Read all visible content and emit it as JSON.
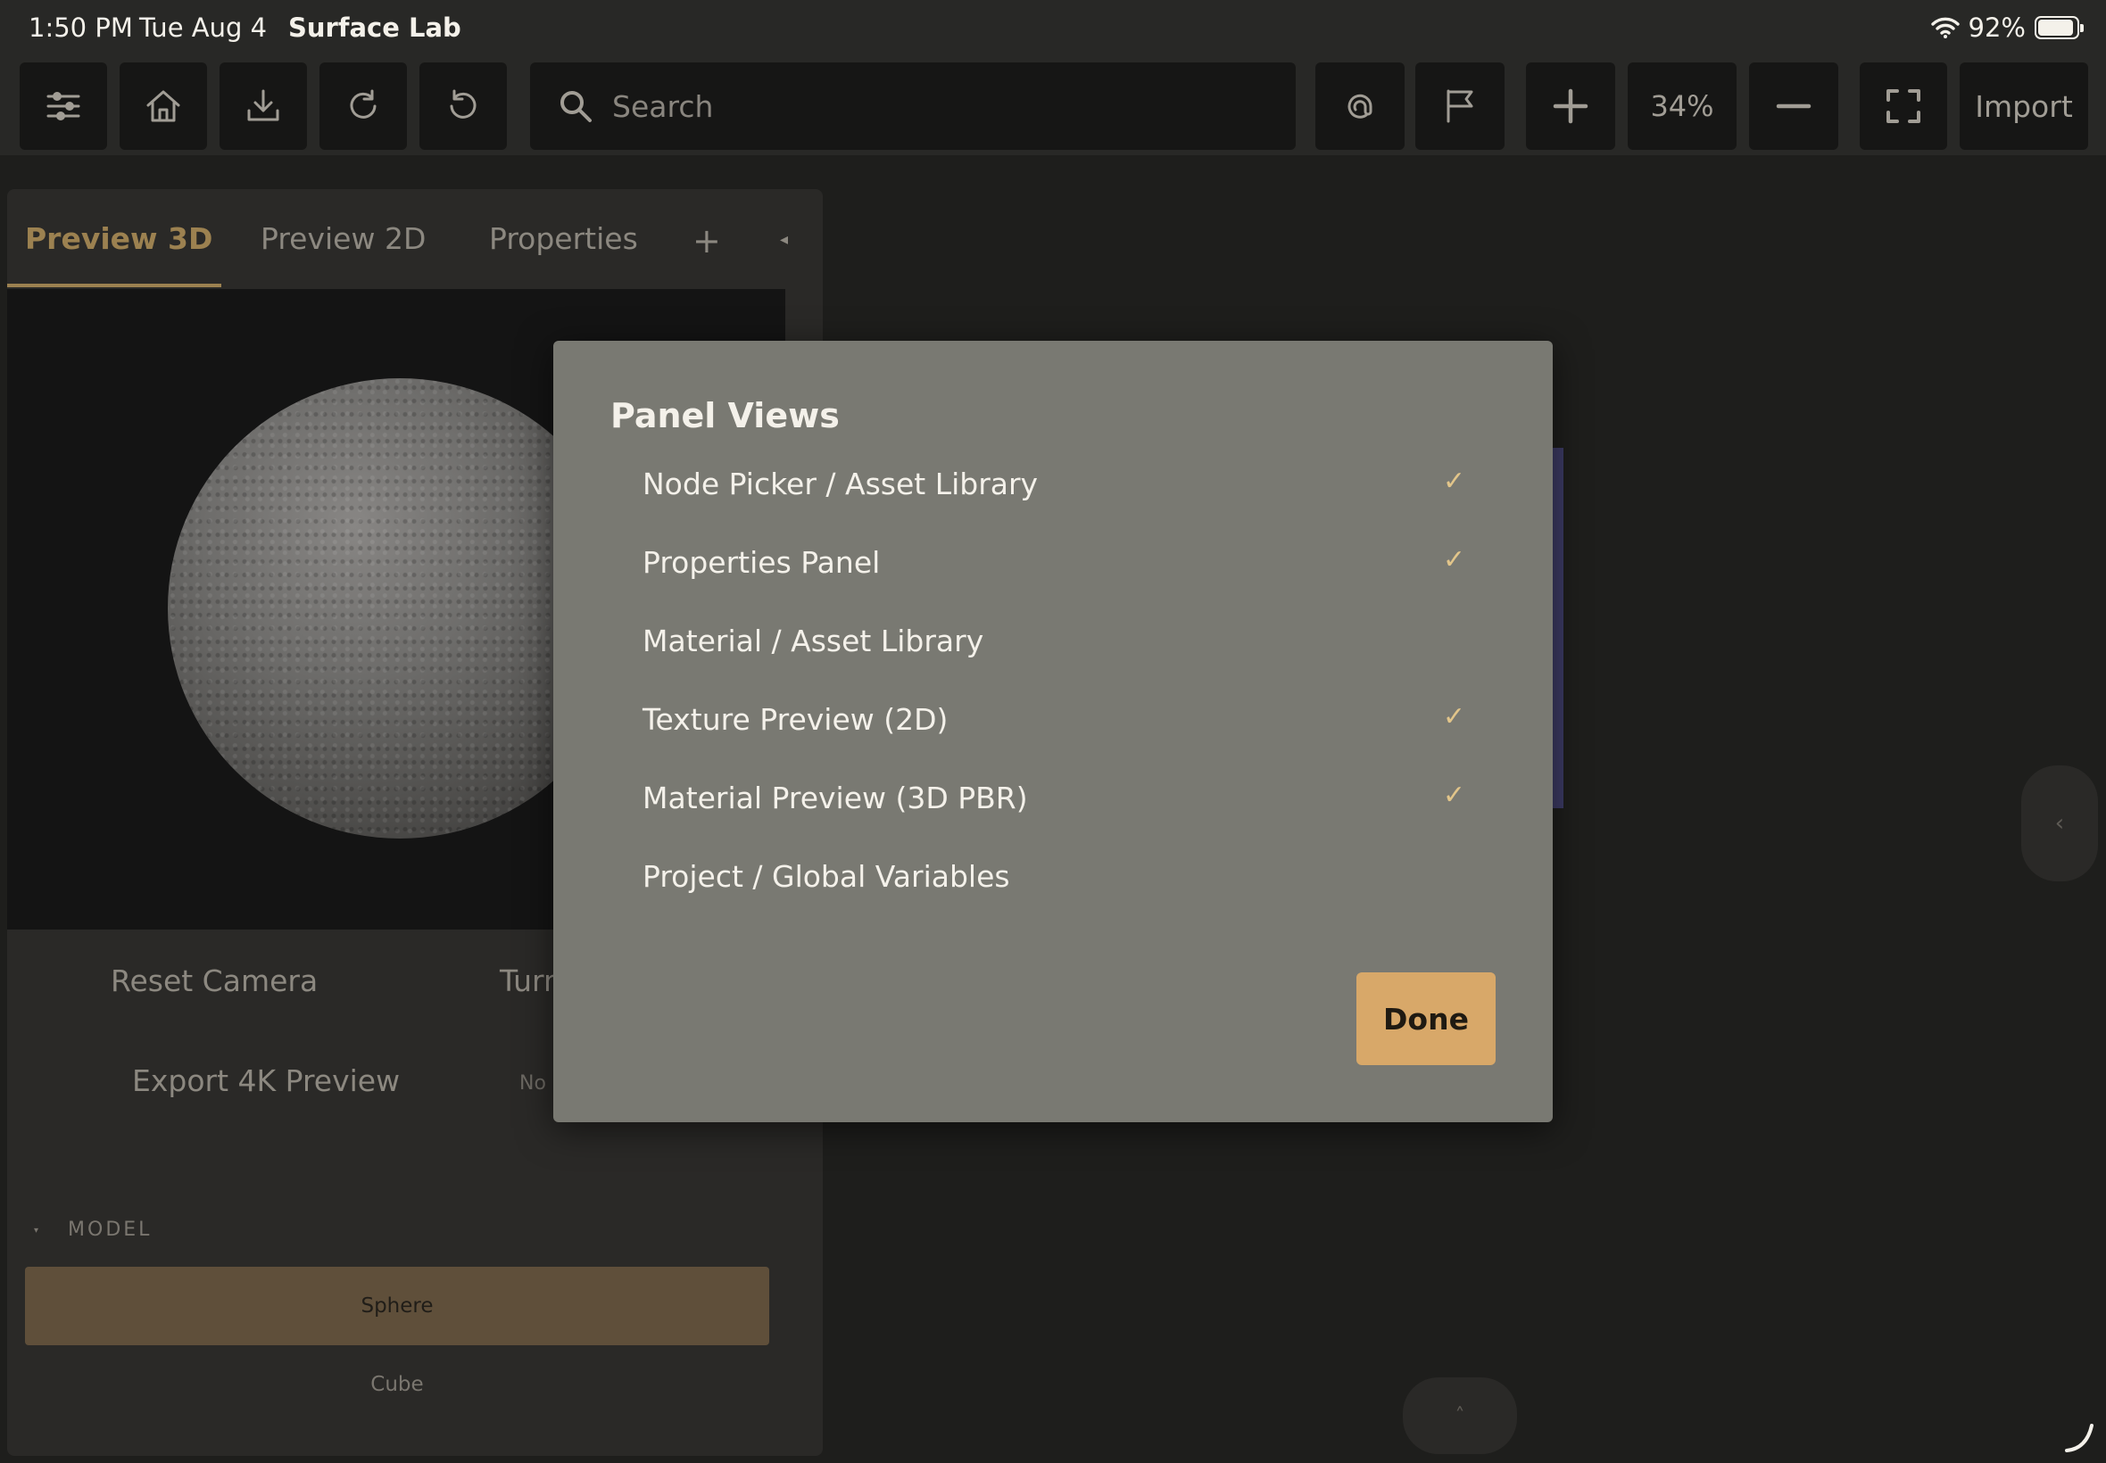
{
  "status_bar": {
    "time": "1:50 PM",
    "date": "Tue Aug 4",
    "app_name": "Surface Lab",
    "battery": "92%",
    "battery_level": 0.92
  },
  "toolbar": {
    "search_placeholder": "Search",
    "zoom": "34%",
    "import_label": "Import"
  },
  "left_panel": {
    "tabs": [
      {
        "label": "Preview 3D",
        "active": true
      },
      {
        "label": "Preview 2D",
        "active": false
      },
      {
        "label": "Properties",
        "active": false
      }
    ],
    "add_tab": "+",
    "reset_camera": "Reset Camera",
    "turntable_partial": "Turn",
    "export_label": "Export 4K Preview",
    "export_status_partial": "No",
    "model_section": "MODEL",
    "model_options": [
      "Sphere",
      "Cube"
    ],
    "model_selected": "Sphere"
  },
  "modal": {
    "title": "Panel Views",
    "items": [
      {
        "label": "Node Picker / Asset Library",
        "checked": true
      },
      {
        "label": "Properties Panel",
        "checked": true
      },
      {
        "label": "Material / Asset Library",
        "checked": false
      },
      {
        "label": "Texture Preview (2D)",
        "checked": true
      },
      {
        "label": "Material Preview (3D PBR)",
        "checked": true
      },
      {
        "label": "Project / Global Variables",
        "checked": false
      }
    ],
    "check_glyph": "✓",
    "done_label": "Done"
  },
  "colors": {
    "accent": "#d8a869",
    "tab_active": "#9c8150",
    "modal_bg": "#797972",
    "app_bg": "#1e1e1c"
  }
}
